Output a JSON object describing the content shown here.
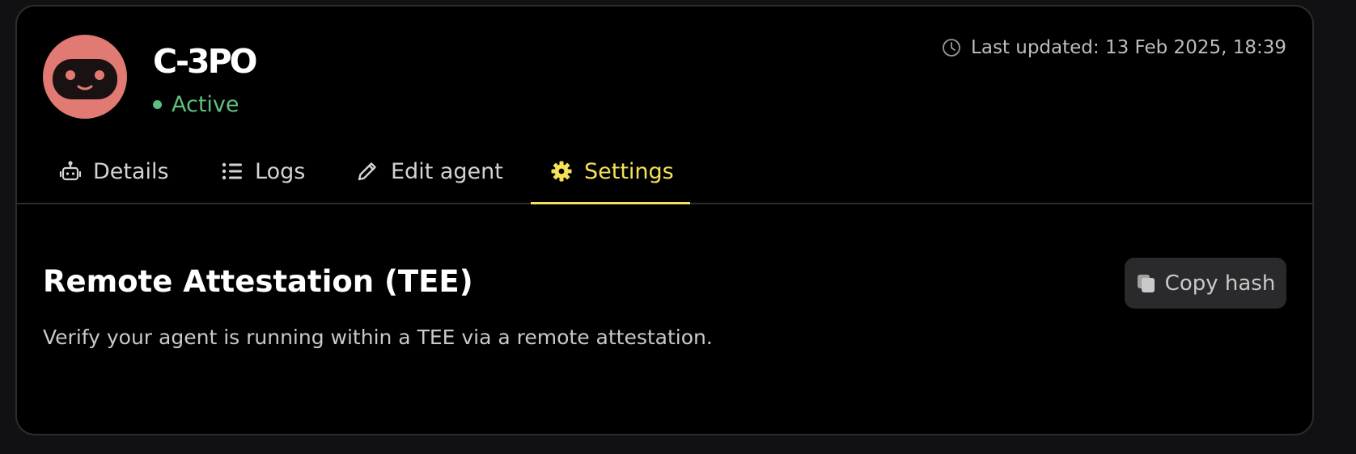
{
  "agent": {
    "name": "C-3PO",
    "status": "Active"
  },
  "header": {
    "last_updated": "Last updated: 13 Feb 2025, 18:39"
  },
  "tabs": [
    {
      "label": "Details",
      "icon": "robot-icon",
      "active": false
    },
    {
      "label": "Logs",
      "icon": "list-icon",
      "active": false
    },
    {
      "label": "Edit agent",
      "icon": "pencil-icon",
      "active": false
    },
    {
      "label": "Settings",
      "icon": "gear-icon",
      "active": true
    }
  ],
  "section": {
    "title": "Remote Attestation (TEE)",
    "description": "Verify your agent is running within a TEE via a remote attestation.",
    "copy_button": "Copy hash"
  },
  "colors": {
    "accent": "#f5e25a",
    "status_active": "#5dc07f",
    "avatar_bg": "#e07a72",
    "card_bg": "#000000"
  }
}
